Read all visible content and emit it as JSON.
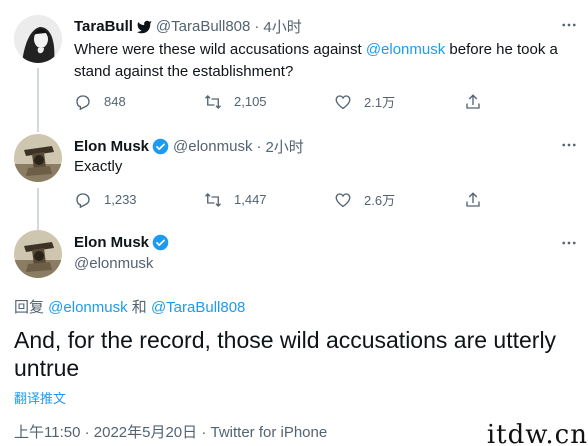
{
  "tweet1": {
    "name": "TaraBull",
    "handle": "@TaraBull808",
    "separator": "·",
    "time": "4小时",
    "text_before": "Where were these wild accusations against ",
    "mention": "@elonmusk",
    "text_after": " before he took a stand against the establishment?",
    "replies": "848",
    "retweets": "2,105",
    "likes": "2.1万"
  },
  "tweet2": {
    "name": "Elon Musk",
    "handle": "@elonmusk",
    "separator": "·",
    "time": "2小时",
    "text": "Exactly",
    "replies": "1,233",
    "retweets": "1,447",
    "likes": "2.6万"
  },
  "main_tweet": {
    "name": "Elon Musk",
    "handle": "@elonmusk",
    "reply_prefix": "回复 ",
    "reply_mention_1": "@elonmusk",
    "reply_and": " 和 ",
    "reply_mention_2": "@TaraBull808",
    "text": "And, for the record, those wild accusations are utterly untrue",
    "translate_label": "翻译推文",
    "timestamp": "上午11:50 · 2022年5月20日 · ",
    "source": "Twitter for iPhone"
  },
  "watermark": "itdw.cn",
  "colors": {
    "accent": "#1d9bf0",
    "secondary_text": "#536471",
    "primary_text": "#0f1419"
  },
  "icons": [
    "reply-icon",
    "retweet-icon",
    "like-icon",
    "share-icon",
    "verified-badge-icon",
    "more-icon"
  ]
}
